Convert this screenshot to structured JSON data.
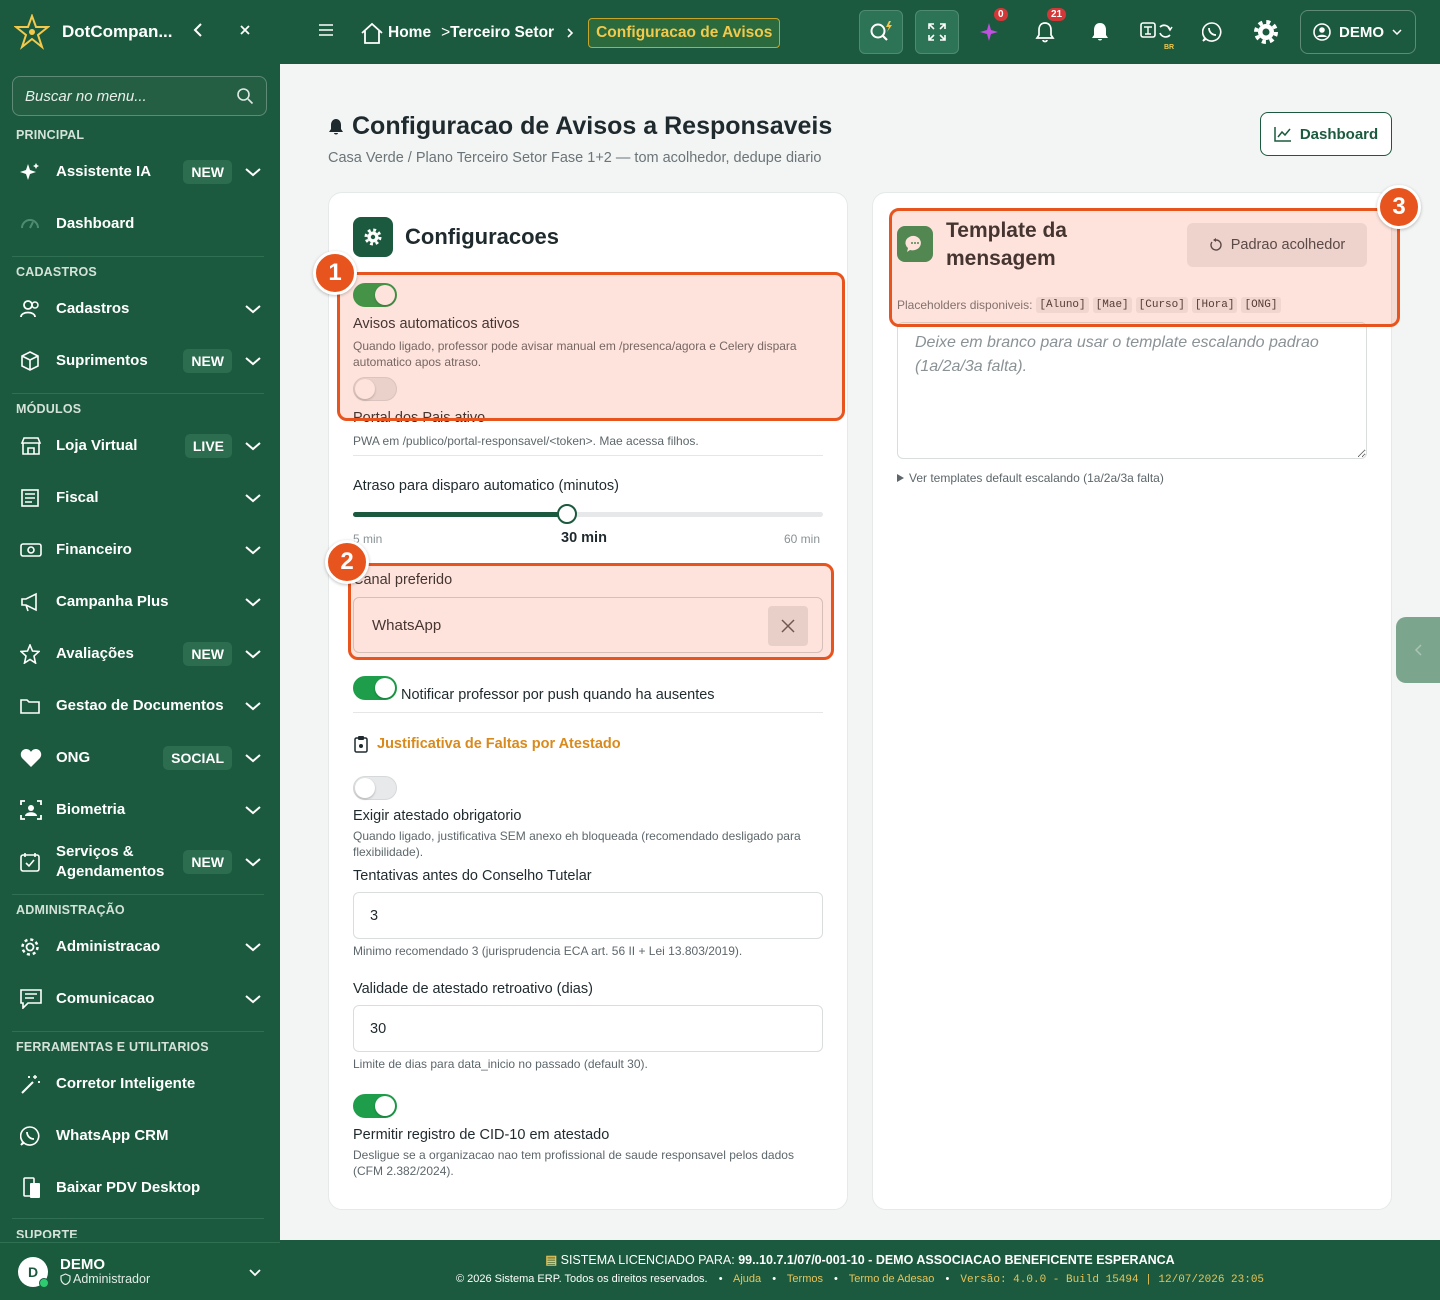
{
  "brand": {
    "name": "DotCompan..."
  },
  "search": {
    "placeholder": "Buscar no menu..."
  },
  "sidebar": {
    "sections": [
      "PRINCIPAL",
      "CADASTROS",
      "MÓDULOS",
      "ADMINISTRAÇÃO",
      "FERRAMENTAS E UTILITARIOS",
      "SUPORTE"
    ],
    "items": [
      {
        "label": "Assistente IA",
        "badge": "NEW"
      },
      {
        "label": "Dashboard"
      },
      {
        "label": "Cadastros"
      },
      {
        "label": "Suprimentos",
        "badge": "NEW"
      },
      {
        "label": "Loja Virtual",
        "badge": "LIVE"
      },
      {
        "label": "Fiscal"
      },
      {
        "label": "Financeiro"
      },
      {
        "label": "Campanha Plus"
      },
      {
        "label": "Avaliações",
        "badge": "NEW"
      },
      {
        "label": "Gestao de Documentos"
      },
      {
        "label": "ONG",
        "badge": "SOCIAL"
      },
      {
        "label": "Biometria"
      },
      {
        "label": "Serviços & Agendamentos",
        "badge": "NEW"
      },
      {
        "label": "Administracao"
      },
      {
        "label": "Comunicacao"
      },
      {
        "label": "Corretor Inteligente"
      },
      {
        "label": "WhatsApp CRM"
      },
      {
        "label": "Baixar PDV Desktop"
      }
    ],
    "user": {
      "initial": "D",
      "name": "DEMO",
      "role": "Administrador"
    }
  },
  "topbar": {
    "breadcrumb": {
      "home": "Home",
      "section": "Terceiro Setor",
      "current": "Configuracao de Avisos"
    },
    "ai_count": "0",
    "notif_count": "21",
    "lang": "BR",
    "user_label": "DEMO"
  },
  "page": {
    "title": "Configuracao de Avisos a Responsaveis",
    "subtitle": "Casa Verde / Plano Terceiro Setor Fase 1+2 — tom acolhedor, dedupe diario",
    "dashboard_button": "Dashboard"
  },
  "config": {
    "title": "Configuracoes",
    "auto_label": "Avisos automaticos ativos",
    "auto_help": "Quando ligado, professor pode avisar manual em /presenca/agora e Celery dispara automatico apos atraso.",
    "portal_label": "Portal dos Pais ativo",
    "portal_help": "PWA em /publico/portal-responsavel/<token>. Mae acessa filhos.",
    "delay_label": "Atraso para disparo automatico (minutos)",
    "delay_min": "5 min",
    "delay_value": "30 min",
    "delay_max": "60 min",
    "delay_fraction": 0.455,
    "channel_label": "Canal preferido",
    "channel_value": "WhatsApp",
    "push_label": "Notificar professor por push quando ha ausentes",
    "justif_title": "Justificativa de Faltas por Atestado",
    "atestado_label": "Exigir atestado obrigatorio",
    "atestado_help": "Quando ligado, justificativa SEM anexo eh bloqueada (recomendado desligado para flexibilidade).",
    "tentativas_label": "Tentativas antes do Conselho Tutelar",
    "tentativas_value": "3",
    "tentativas_help": "Minimo recomendado 3 (jurisprudencia ECA art. 56 II + Lei 13.803/2019).",
    "validade_label": "Validade de atestado retroativo (dias)",
    "validade_value": "30",
    "validade_help": "Limite de dias para data_inicio no passado (default 30).",
    "cid_label": "Permitir registro de CID-10 em atestado",
    "cid_help": "Desligue se a organizacao nao tem profissional de saude responsavel pelos dados (CFM 2.382/2024)."
  },
  "template": {
    "title": "Template da mensagem",
    "reset_button": "Padrao acolhedor",
    "placeholders_label": "Placeholders disponiveis:",
    "placeholders": [
      "[Aluno]",
      "[Mae]",
      "[Curso]",
      "[Hora]",
      "[ONG]"
    ],
    "textarea_placeholder": "Deixe em branco para usar o template escalando padrao (1a/2a/3a falta).",
    "details_label": "Ver templates default escalando (1a/2a/3a falta)"
  },
  "annotations": [
    "1",
    "2",
    "3"
  ],
  "footer": {
    "license_label": "SISTEMA LICENCIADO PARA:",
    "license_value": "99..10.7.1/07/0-001-10 - DEMO ASSOCIACAO BENEFICENTE ESPERANCA",
    "copyright": "© 2026 Sistema ERP. Todos os direitos reservados.",
    "links": [
      "Ajuda",
      "Termos",
      "Termo de Adesao"
    ],
    "version": "Versão: 4.0.0 - Build 15494 | 12/07/2026 23:05"
  },
  "colors": {
    "primary": "#1b5a3e",
    "accent": "#e8541e",
    "gold": "#f2c94c",
    "toggle_on": "#1e9e4a"
  }
}
